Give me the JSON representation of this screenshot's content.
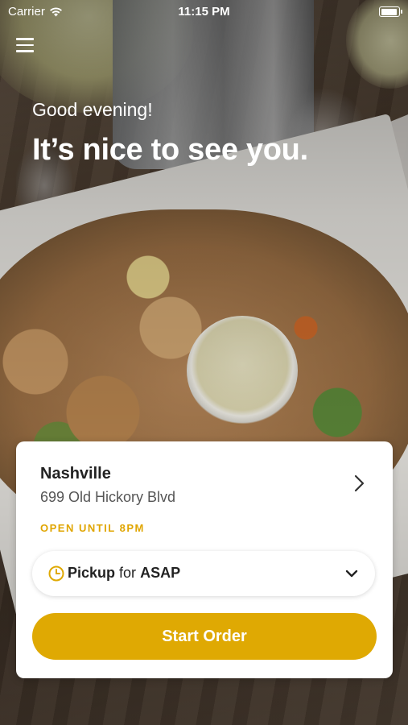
{
  "status_bar": {
    "carrier": "Carrier",
    "time": "11:15 PM"
  },
  "hero": {
    "greeting": "Good evening!",
    "headline": "It’s nice to see you."
  },
  "location": {
    "name": "Nashville",
    "address": "699 Old Hickory Blvd",
    "hours": "OPEN UNTIL 8PM"
  },
  "order_mode": {
    "mode": "Pickup",
    "connector": "for",
    "time": "ASAP"
  },
  "cta": {
    "label": "Start Order"
  },
  "icons": {
    "menu": "hamburger-menu-icon",
    "location_chevron": "chevron-right-icon",
    "clock": "clock-icon",
    "dropdown": "chevron-down-icon",
    "wifi": "wifi-icon",
    "battery": "battery-icon"
  },
  "colors": {
    "accent": "#dfa903",
    "hours_text": "#e0a500",
    "card_bg": "#ffffff"
  }
}
